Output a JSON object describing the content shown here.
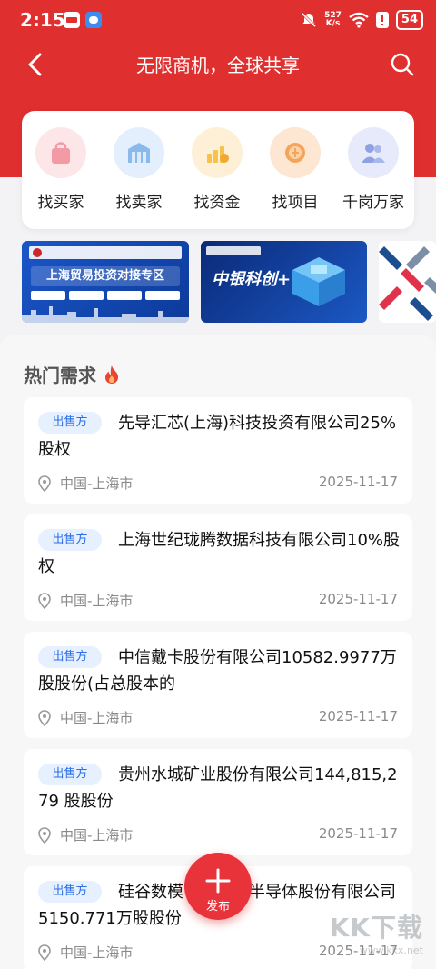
{
  "status_bar": {
    "time": "2:15",
    "net_speed_value": "527",
    "net_speed_unit": "K/s",
    "battery": "54"
  },
  "nav": {
    "title": "无限商机，全球共享"
  },
  "categories": [
    {
      "label": "找买家",
      "icon": "shopping-bag-icon",
      "color": "#f6b1b8"
    },
    {
      "label": "找卖家",
      "icon": "storefront-icon",
      "color": "#9cc6f0"
    },
    {
      "label": "找资金",
      "icon": "coins-chart-icon",
      "color": "#f5c24c"
    },
    {
      "label": "找项目",
      "icon": "project-coin-icon",
      "color": "#f3a55c"
    },
    {
      "label": "千岗万家",
      "icon": "people-icon",
      "color": "#9fb0e8"
    }
  ],
  "banners": [
    {
      "title": "上海贸易投资对接专区"
    },
    {
      "title": "中银科创+"
    }
  ],
  "hot": {
    "title": "热门需求"
  },
  "demands": [
    {
      "tag": "出售方",
      "title": "先导汇芯(上海)科技投资有限公司25%股权",
      "location": "中国-上海市",
      "date": "2025-11-17"
    },
    {
      "tag": "出售方",
      "title": "上海世纪珑腾数据科技有限公司10%股权",
      "location": "中国-上海市",
      "date": "2025-11-17"
    },
    {
      "tag": "出售方",
      "title": "中信戴卡股份有限公司10582.9977万股股份(占总股本的",
      "location": "中国-上海市",
      "date": "2025-11-17"
    },
    {
      "tag": "出售方",
      "title": "贵州水城矿业股份有限公司144,815,279 股股份",
      "location": "中国-上海市",
      "date": "2025-11-17"
    },
    {
      "tag": "出售方",
      "title": "硅谷数模（苏州）半导体股份有限公司5150.771万股股份",
      "location": "中国-上海市",
      "date": "2025-11-17"
    }
  ],
  "fab": {
    "label": "发布"
  },
  "watermark": {
    "text": "KK下载",
    "url": "www.kkx.net"
  },
  "colors": {
    "primary_red": "#e02f2f",
    "tag_blue": "#2a6ee8",
    "tag_bg": "#e6f0ff"
  }
}
